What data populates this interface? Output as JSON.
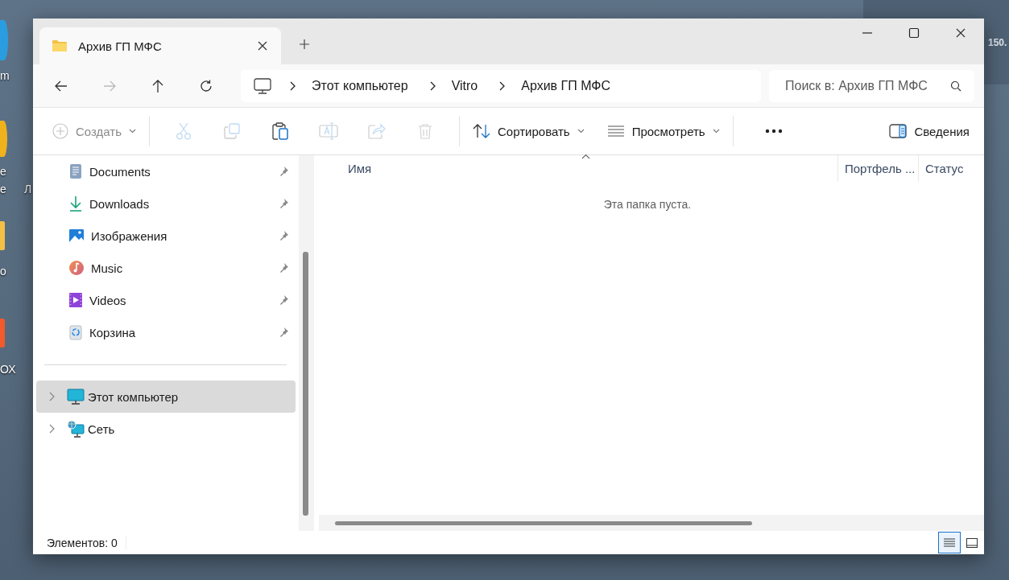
{
  "desktop": {
    "icon_fragments": [
      {
        "text": "m",
        "kind": "blue"
      },
      {
        "text": "е",
        "kind": "yellow"
      },
      {
        "text": "е",
        "kind": "none"
      },
      {
        "text": "Л",
        "kind": "none"
      },
      {
        "text": "о",
        "kind": "folder"
      },
      {
        "text": "ОХ",
        "kind": "orange"
      }
    ],
    "web_panel": {
      "value": "150."
    }
  },
  "window": {
    "tab": {
      "title": "Архив ГП МФС",
      "selected": true
    },
    "address": {
      "breadcrumbs": [
        "Этот компьютер",
        "Vitro",
        "Архив ГП МФС"
      ],
      "search_placeholder": "Поиск в: Архив ГП МФС"
    },
    "nav": [
      {
        "kind": "back",
        "disabled": false
      },
      {
        "kind": "forward",
        "disabled": true
      },
      {
        "kind": "up",
        "disabled": false
      },
      {
        "kind": "refresh",
        "disabled": false
      }
    ],
    "toolbar": [
      {
        "kind": "new",
        "label": "Создать",
        "disabled": true
      },
      {
        "kind": "cut",
        "disabled": true
      },
      {
        "kind": "copy",
        "disabled": true
      },
      {
        "kind": "paste",
        "disabled": false
      },
      {
        "kind": "rename",
        "disabled": true
      },
      {
        "kind": "share",
        "disabled": true
      },
      {
        "kind": "delete",
        "disabled": true
      },
      {
        "kind": "sort",
        "label": "Сортировать",
        "disabled": false
      },
      {
        "kind": "view",
        "label": "Просмотреть",
        "disabled": false
      },
      {
        "kind": "more",
        "disabled": false
      },
      {
        "kind": "details",
        "label": "Сведения",
        "disabled": false
      }
    ],
    "sidebar": {
      "quick_access": [
        {
          "kind": "documents",
          "label": "Documents",
          "pinned": true
        },
        {
          "kind": "downloads",
          "label": "Downloads",
          "pinned": true
        },
        {
          "kind": "pictures",
          "label": "Изображения",
          "pinned": true
        },
        {
          "kind": "music",
          "label": "Music",
          "pinned": true
        },
        {
          "kind": "videos",
          "label": "Videos",
          "pinned": true
        },
        {
          "kind": "recycle",
          "label": "Корзина",
          "pinned": true
        }
      ],
      "tree": [
        {
          "kind": "computer",
          "label": "Этот компьютер",
          "selected": true,
          "expanded": false
        },
        {
          "kind": "network",
          "label": "Сеть",
          "selected": false,
          "expanded": false
        }
      ]
    },
    "table": {
      "columns": [
        {
          "label": "Имя",
          "sorted": true
        },
        {
          "label": "Портфель ...",
          "sorted": false
        },
        {
          "label": "Статус",
          "sorted": false
        }
      ],
      "empty_message": "Эта папка пуста."
    },
    "status_bar": {
      "count": "Элементов: 0",
      "views": [
        {
          "kind": "details",
          "selected": true
        },
        {
          "kind": "tiles",
          "selected": false
        }
      ]
    }
  }
}
